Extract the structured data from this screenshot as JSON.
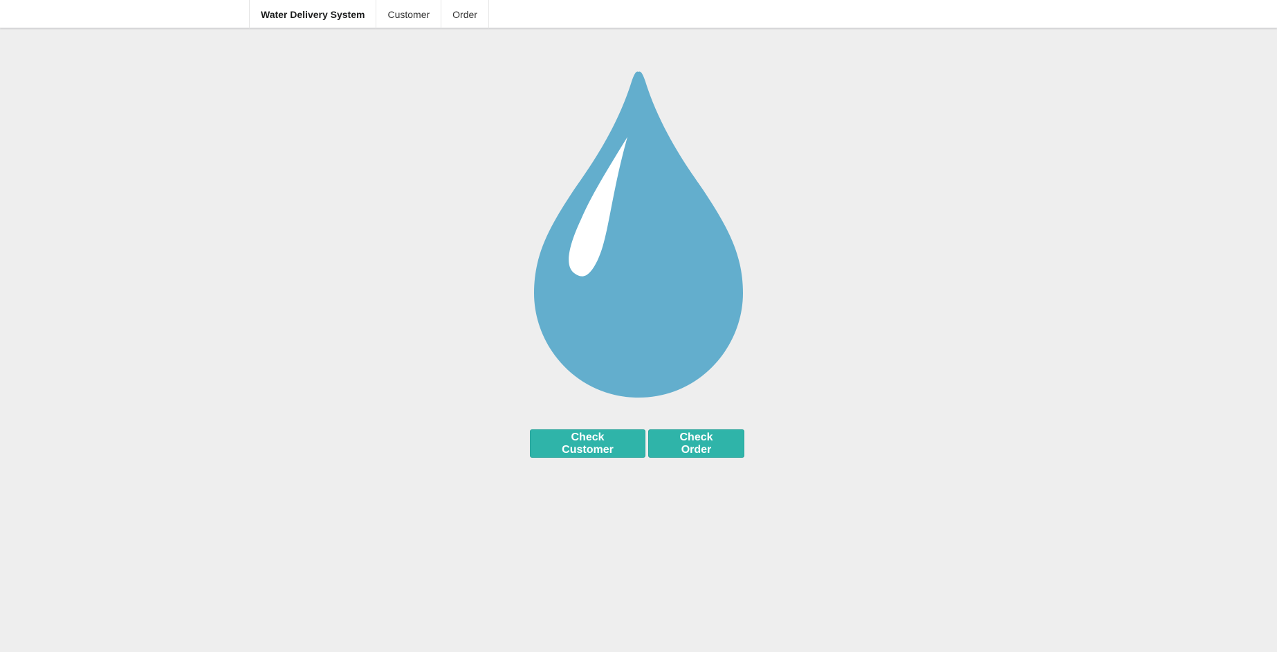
{
  "navbar": {
    "brand": "Water Delivery System",
    "items": [
      {
        "label": "Customer"
      },
      {
        "label": "Order"
      }
    ]
  },
  "hero": {
    "icon": "water-drop-icon",
    "drop_color": "#63aecd",
    "highlight_color": "#ffffff"
  },
  "actions": {
    "check_customer_label": "Check Customer",
    "check_order_label": "Check Order",
    "button_color": "#2fb4a9"
  }
}
